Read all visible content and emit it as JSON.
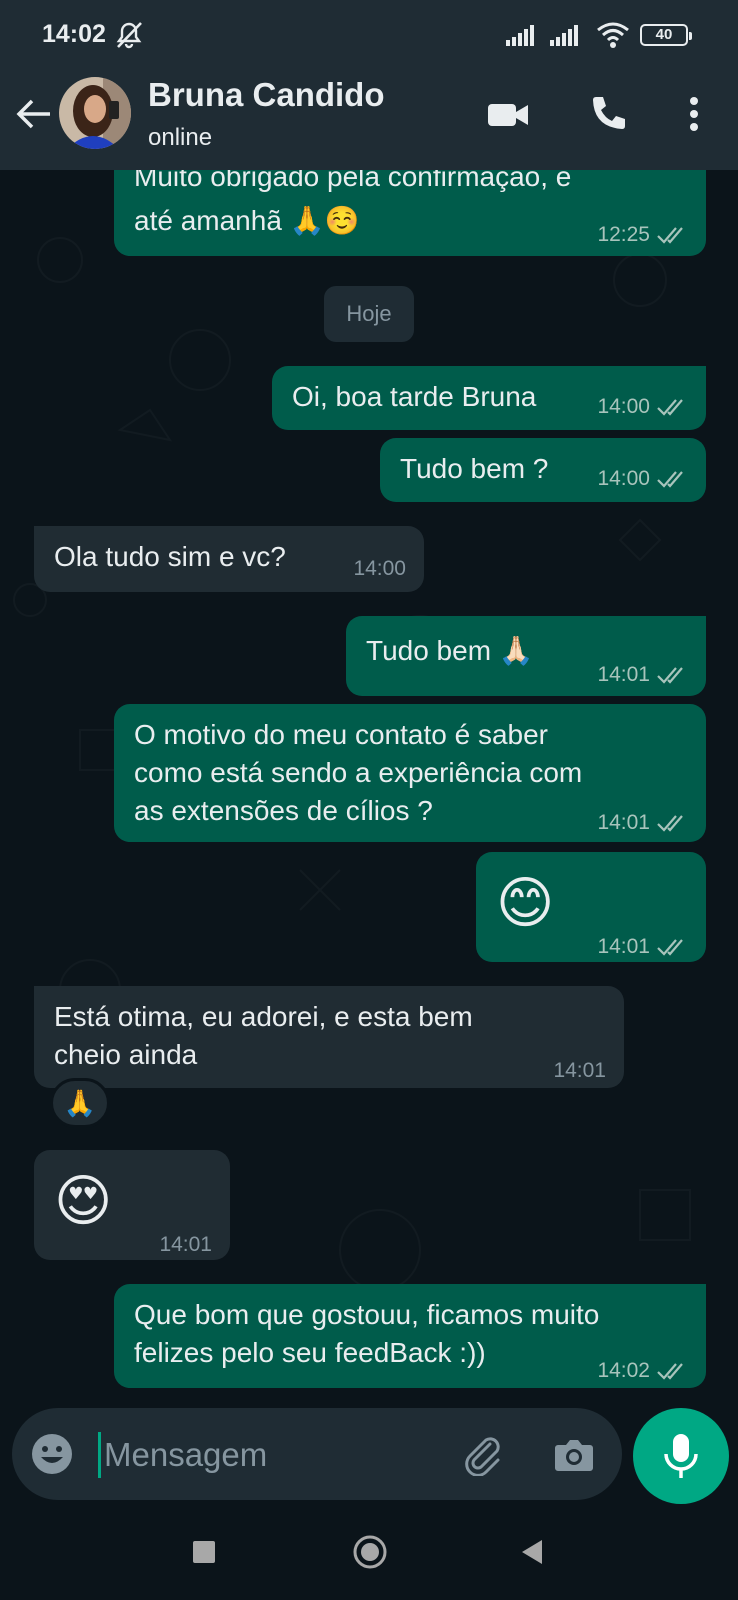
{
  "status_bar": {
    "time": "14:02",
    "battery": "40"
  },
  "header": {
    "contact_name": "Bruna Candido",
    "contact_status": "online"
  },
  "messages": [
    {
      "direction": "out",
      "lines": [
        "Muito obrigado pela confirmação, e",
        "até amanhã 🙏☺️"
      ],
      "time": "12:25",
      "read": true
    },
    {
      "direction": "out",
      "lines": [
        "Oi, boa tarde Bruna"
      ],
      "time": "14:00",
      "read": true
    },
    {
      "direction": "out",
      "lines": [
        "Tudo bem ?"
      ],
      "time": "14:00",
      "read": true
    },
    {
      "direction": "in",
      "lines": [
        "Ola tudo sim e vc?"
      ],
      "time": "14:00"
    },
    {
      "direction": "out",
      "lines": [
        "Tudo bem 🙏🏻"
      ],
      "time": "14:01",
      "read": true
    },
    {
      "direction": "out",
      "lines": [
        "O motivo do meu contato é saber",
        "como está sendo a experiência com",
        "as extensões de cílios ?"
      ],
      "time": "14:01",
      "read": true
    },
    {
      "direction": "out",
      "lines": [
        "😊"
      ],
      "time": "14:01",
      "read": true
    },
    {
      "direction": "in",
      "lines": [
        "Está otima, eu adorei, e esta bem",
        "cheio ainda"
      ],
      "time": "14:01",
      "reaction": "🙏"
    },
    {
      "direction": "in",
      "lines": [
        "😍"
      ],
      "time": "14:01"
    },
    {
      "direction": "out",
      "lines": [
        "Que bom que gostouu, ficamos muito",
        "felizes pelo seu feedBack :))"
      ],
      "time": "14:02",
      "read": true
    }
  ],
  "day_divider": "Hoje",
  "composer": {
    "placeholder": "Mensagem"
  },
  "colors": {
    "outgoing_bubble": "#005c4b",
    "incoming_bubble": "#202c33",
    "accent": "#00a884",
    "background": "#0b141a",
    "header": "#1f2c34"
  },
  "icons": [
    "mute-icon",
    "signal-icon",
    "wifi-icon",
    "back-arrow-icon",
    "video-call-icon",
    "voice-call-icon",
    "more-options-icon",
    "double-check-icon",
    "emoji-icon",
    "attach-icon",
    "camera-icon",
    "mic-icon",
    "nav-recents-icon",
    "nav-home-icon",
    "nav-back-icon"
  ]
}
